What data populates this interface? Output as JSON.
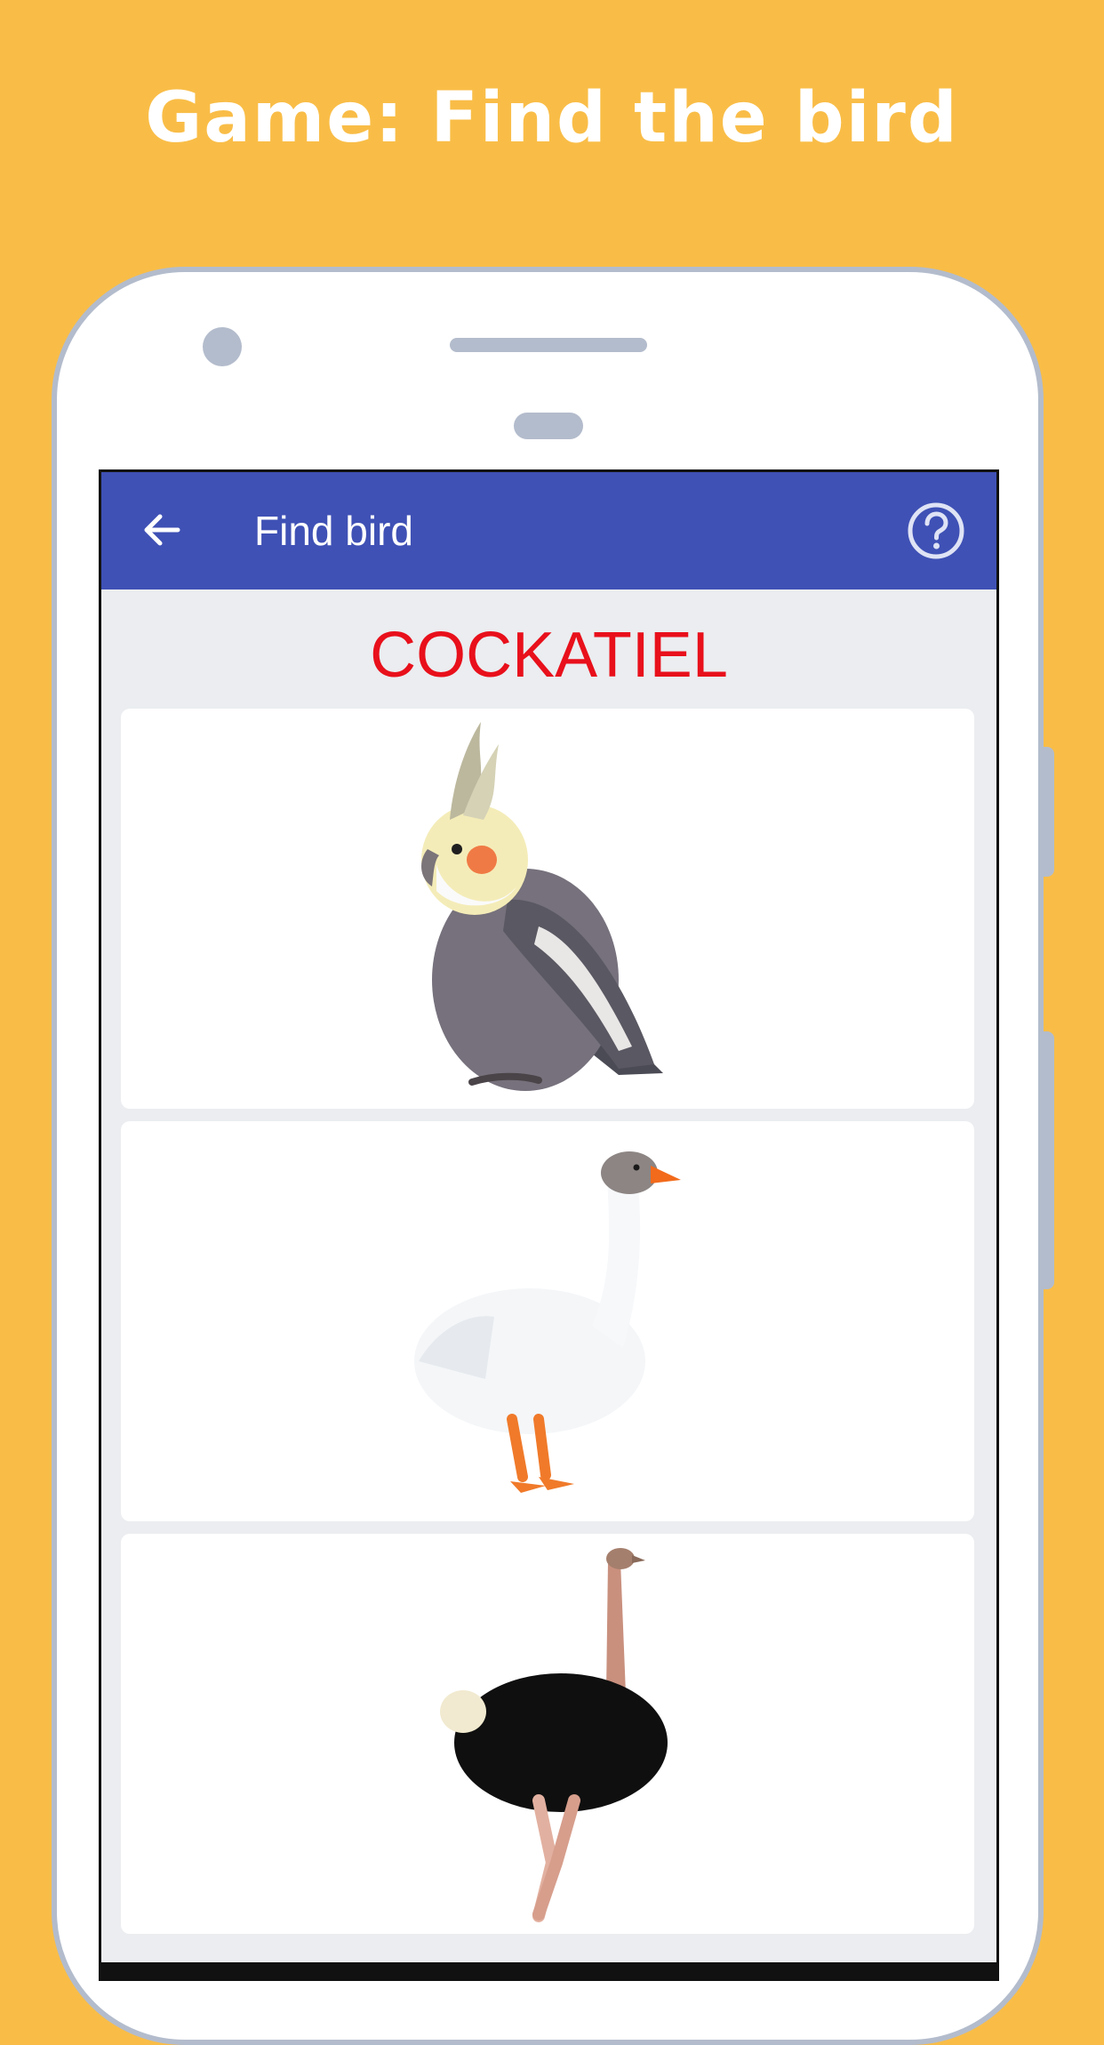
{
  "promo": {
    "title": "Game: Find the bird"
  },
  "appbar": {
    "title": "Find bird",
    "back_icon": "arrow-left-icon",
    "help_icon": "help-circle-icon"
  },
  "game": {
    "target_word": "COCKATIEL",
    "choices": [
      {
        "icon": "cockatiel-image"
      },
      {
        "icon": "goose-image"
      },
      {
        "icon": "ostrich-image"
      }
    ]
  },
  "colors": {
    "background": "#f9bd47",
    "appbar": "#3f51b5",
    "target_word": "#e8101b",
    "screen_bg": "#ebedf0",
    "phone_frame": "#b3bccc"
  }
}
